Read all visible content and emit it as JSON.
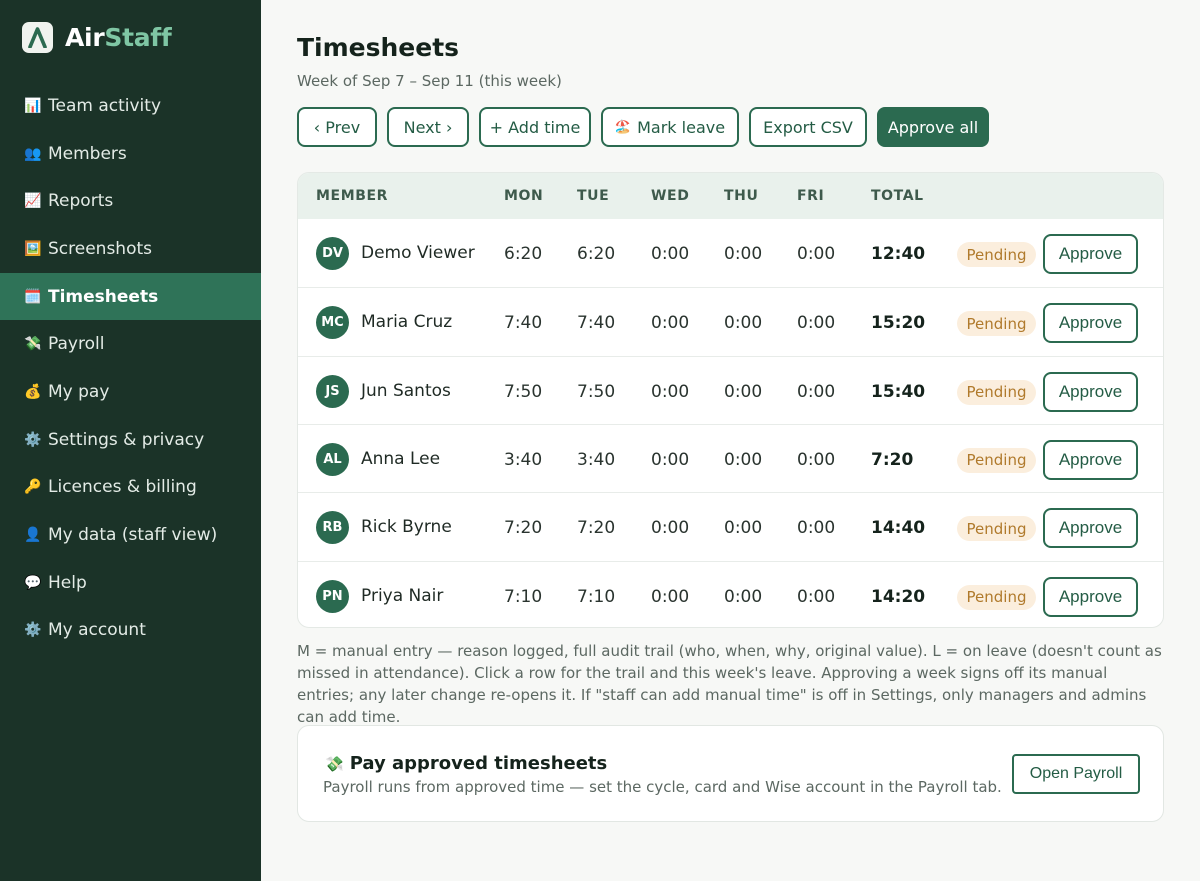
{
  "app": {
    "brand_part1": "Air",
    "brand_part2": "Staff",
    "accent_color": "#7fc6a4",
    "primary_color": "#2b6a50",
    "sidebar_color": "#1b3328"
  },
  "sidebar": {
    "items": [
      {
        "icon": "📊",
        "icon_name": "bar-chart-icon",
        "label": "Team activity",
        "active": false
      },
      {
        "icon": "👥",
        "icon_name": "members-icon",
        "label": "Members",
        "active": false
      },
      {
        "icon": "📈",
        "icon_name": "trend-chart-icon",
        "label": "Reports",
        "active": false
      },
      {
        "icon": "🖼️",
        "icon_name": "picture-icon",
        "label": "Screenshots",
        "active": false
      },
      {
        "icon": "🗓️",
        "icon_name": "calendar-icon",
        "label": "Timesheets",
        "active": true
      },
      {
        "icon": "💸",
        "icon_name": "money-wings-icon",
        "label": "Payroll",
        "active": false
      },
      {
        "icon": "💰",
        "icon_name": "money-bag-icon",
        "label": "My pay",
        "active": false
      },
      {
        "icon": "⚙️",
        "icon_name": "gear-icon",
        "label": "Settings & privacy",
        "active": false
      },
      {
        "icon": "🔑",
        "icon_name": "key-icon",
        "label": "Licences & billing",
        "active": false
      },
      {
        "icon": "👤",
        "icon_name": "user-icon",
        "label": "My data (staff view)",
        "active": false
      },
      {
        "icon": "💬",
        "icon_name": "speech-bubble-icon",
        "label": "Help",
        "active": false
      },
      {
        "icon": "⚙️",
        "icon_name": "gear-icon",
        "label": "My account",
        "active": false
      }
    ]
  },
  "header": {
    "title": "Timesheets",
    "subtitle": "Week of Sep 7 – Sep 11 (this week)"
  },
  "toolbar": {
    "prev_label": "‹ Prev",
    "next_label": "Next ›",
    "add_time_label": "+ Add time",
    "mark_leave_icon": "🏖️",
    "mark_leave_label": "Mark leave",
    "export_label": "Export CSV",
    "approve_all_label": "Approve all"
  },
  "table": {
    "columns": {
      "member": "MEMBER",
      "mon": "MON",
      "tue": "TUE",
      "wed": "WED",
      "thu": "THU",
      "fri": "FRI",
      "total": "TOTAL"
    },
    "rows": [
      {
        "initials": "DV",
        "name": "Demo Viewer",
        "mon": "6:20",
        "tue": "6:20",
        "wed": "0:00",
        "thu": "0:00",
        "fri": "0:00",
        "total": "12:40",
        "status": "Pending",
        "action": "Approve"
      },
      {
        "initials": "MC",
        "name": "Maria Cruz",
        "mon": "7:40",
        "tue": "7:40",
        "wed": "0:00",
        "thu": "0:00",
        "fri": "0:00",
        "total": "15:20",
        "status": "Pending",
        "action": "Approve"
      },
      {
        "initials": "JS",
        "name": "Jun Santos",
        "mon": "7:50",
        "tue": "7:50",
        "wed": "0:00",
        "thu": "0:00",
        "fri": "0:00",
        "total": "15:40",
        "status": "Pending",
        "action": "Approve"
      },
      {
        "initials": "AL",
        "name": "Anna Lee",
        "mon": "3:40",
        "tue": "3:40",
        "wed": "0:00",
        "thu": "0:00",
        "fri": "0:00",
        "total": "7:20",
        "status": "Pending",
        "action": "Approve"
      },
      {
        "initials": "RB",
        "name": "Rick Byrne",
        "mon": "7:20",
        "tue": "7:20",
        "wed": "0:00",
        "thu": "0:00",
        "fri": "0:00",
        "total": "14:40",
        "status": "Pending",
        "action": "Approve"
      },
      {
        "initials": "PN",
        "name": "Priya Nair",
        "mon": "7:10",
        "tue": "7:10",
        "wed": "0:00",
        "thu": "0:00",
        "fri": "0:00",
        "total": "14:20",
        "status": "Pending",
        "action": "Approve"
      }
    ]
  },
  "note": "M = manual entry — reason logged, full audit trail (who, when, why, original value). L = on leave (doesn't count as missed in attendance). Click a row for the trail and this week's leave. Approving a week signs off its manual entries; any later change re-opens it. If \"staff can add manual time\" is off in Settings, only managers and admins can add time.",
  "payroll_card": {
    "icon": "💸",
    "title": "Pay approved timesheets",
    "description": "Payroll runs from approved time — set the cycle, card and Wise account in the Payroll tab.",
    "button_label": "Open Payroll"
  }
}
